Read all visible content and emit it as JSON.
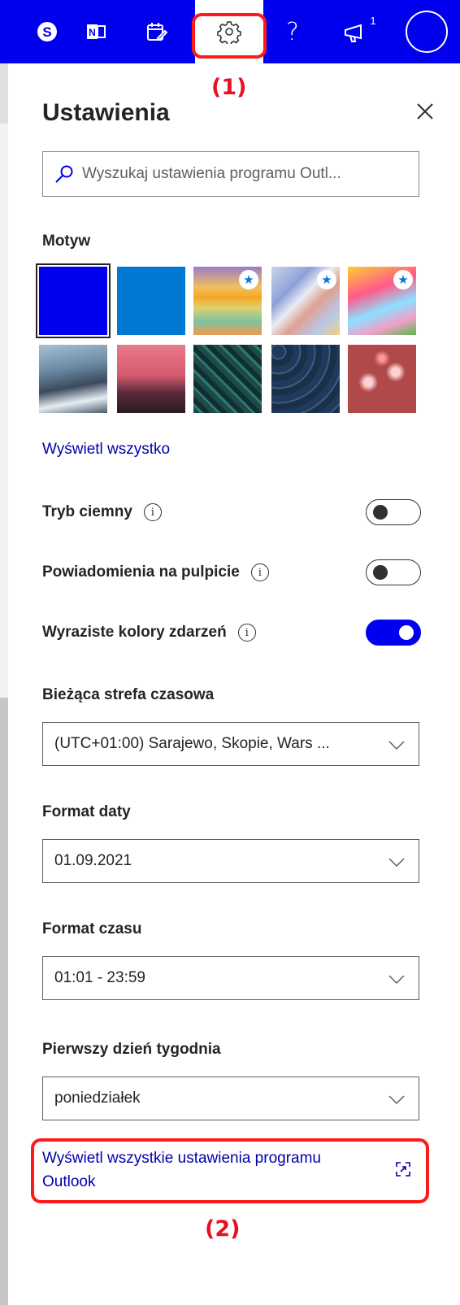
{
  "topbar": {
    "icons": [
      "skype-icon",
      "onenote-icon",
      "calendar-todo-icon",
      "gear-icon",
      "help-icon",
      "megaphone-icon",
      "avatar"
    ],
    "help_glyph": "?",
    "notification_count": "1",
    "bar_color": "#0000ee"
  },
  "annotations": {
    "label_1": "(1)",
    "label_2": "(2)",
    "color": "#ff1a1a"
  },
  "settings": {
    "title": "Ustawienia",
    "close_glyph": "✕",
    "search_placeholder": "Wyszukaj ustawienia programu Outl...",
    "theme_label": "Motyw",
    "themes": [
      {
        "name": "blue-theme",
        "selected": true,
        "premium": false
      },
      {
        "name": "azure-theme",
        "selected": false,
        "premium": false
      },
      {
        "name": "rainbow-theme",
        "selected": false,
        "premium": true
      },
      {
        "name": "ribbons-theme",
        "selected": false,
        "premium": true
      },
      {
        "name": "unicorn-theme",
        "selected": false,
        "premium": true
      },
      {
        "name": "mountain-theme",
        "selected": false,
        "premium": false
      },
      {
        "name": "palms-theme",
        "selected": false,
        "premium": false
      },
      {
        "name": "circuit-theme",
        "selected": false,
        "premium": false
      },
      {
        "name": "elevation-theme",
        "selected": false,
        "premium": false
      },
      {
        "name": "bokeh-theme",
        "selected": false,
        "premium": false
      }
    ],
    "premium_glyph": "★",
    "view_all": "Wyświetl wszystko",
    "dark_mode": {
      "label": "Tryb ciemny",
      "on": false
    },
    "desktop_notifications": {
      "label": "Powiadomienia na pulpicie",
      "on": false
    },
    "vivid_colors": {
      "label": "Wyraziste kolory zdarzeń",
      "on": true
    },
    "info_glyph": "i",
    "timezone": {
      "label": "Bieżąca strefa czasowa",
      "value": "(UTC+01:00) Sarajewo, Skopie, Wars ..."
    },
    "date_format": {
      "label": "Format daty",
      "value": "01.09.2021"
    },
    "time_format": {
      "label": "Format czasu",
      "value": "01:01 - 23:59"
    },
    "first_day": {
      "label": "Pierwszy dzień tygodnia",
      "value": "poniedziałek"
    },
    "view_all_settings": "Wyświetl wszystkie ustawienia programu Outlook"
  }
}
